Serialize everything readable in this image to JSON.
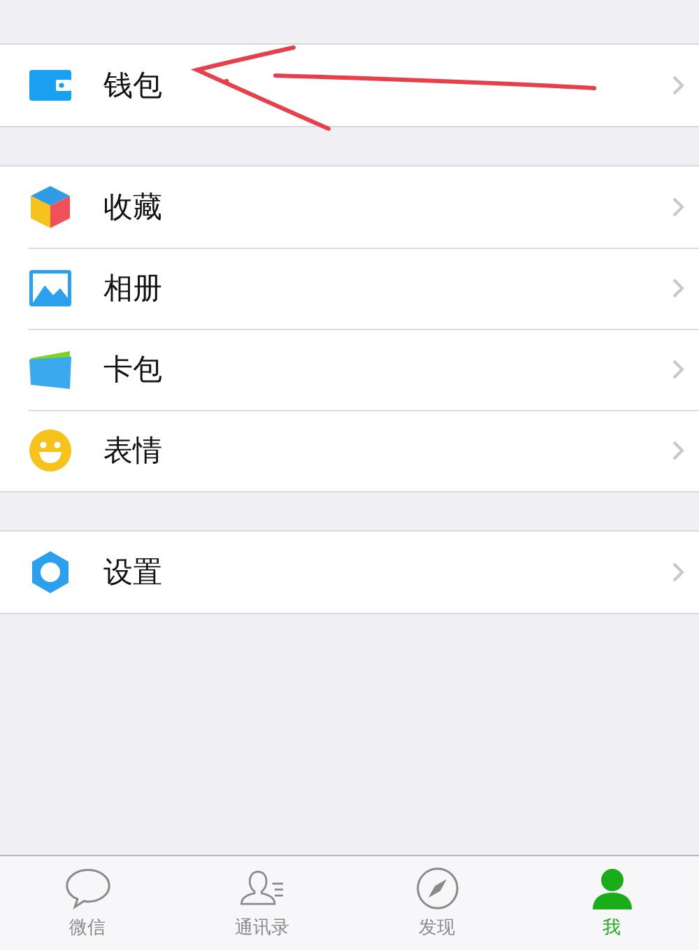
{
  "groups": [
    {
      "items": [
        {
          "kind": "wallet",
          "label": "钱包"
        }
      ]
    },
    {
      "items": [
        {
          "kind": "favorites",
          "label": "收藏"
        },
        {
          "kind": "album",
          "label": "相册"
        },
        {
          "kind": "cards",
          "label": "卡包"
        },
        {
          "kind": "stickers",
          "label": "表情"
        }
      ]
    },
    {
      "items": [
        {
          "kind": "settings",
          "label": "设置"
        }
      ]
    }
  ],
  "annotation": {
    "kind": "arrow"
  },
  "tab_bar": [
    {
      "kind": "chats",
      "label": "微信",
      "selected": false
    },
    {
      "kind": "contacts",
      "label": "通讯录",
      "selected": false
    },
    {
      "kind": "discover",
      "label": "发现",
      "selected": false
    },
    {
      "kind": "me",
      "label": "我",
      "selected": true
    }
  ]
}
